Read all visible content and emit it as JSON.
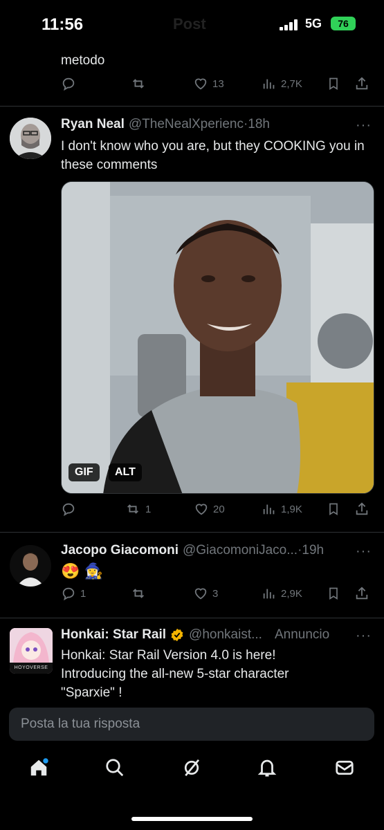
{
  "status_bar": {
    "time": "11:56",
    "title": "Post",
    "network": "5G",
    "battery": "76"
  },
  "tweets": [
    {
      "text": "metodo",
      "replies": "",
      "retweets": "",
      "likes": "13",
      "views": "2,7K"
    },
    {
      "name": "Ryan Neal",
      "handle": "@TheNealXperienc",
      "time": "·18h",
      "more": "···",
      "text": "I don't know who you are, but they COOKING you in these comments",
      "media_badges": {
        "gif": "GIF",
        "alt": "ALT"
      },
      "replies": "",
      "retweets": "1",
      "likes": "20",
      "views": "1,9K"
    },
    {
      "name": "Jacopo Giacomoni",
      "handle": "@GiacomoniJaco...",
      "time": "·19h",
      "more": "···",
      "text": "😍 🧙‍♀️",
      "replies": "1",
      "retweets": "",
      "likes": "3",
      "views": "2,9K"
    },
    {
      "name": "Honkai: Star Rail",
      "handle": "@honkaist...",
      "ad_label": "Annuncio",
      "more": "···",
      "avatar_label": "HOYOVERSE",
      "text_lines": [
        "Honkai: Star Rail Version 4.0 is here!",
        "Introducing the all-new 5-star character",
        "\"Sparxie\" !"
      ]
    }
  ],
  "reply_input": {
    "placeholder": "Posta la tua risposta"
  },
  "tab_bar": [
    "home-icon",
    "search-icon",
    "grok-icon",
    "notifications-icon",
    "messages-icon"
  ],
  "colors": {
    "background": "#000000",
    "text": "#e7e9ea",
    "muted": "#71767b",
    "accent": "#1d9bf0",
    "battery": "#30d158",
    "verified": "#f4b400"
  }
}
